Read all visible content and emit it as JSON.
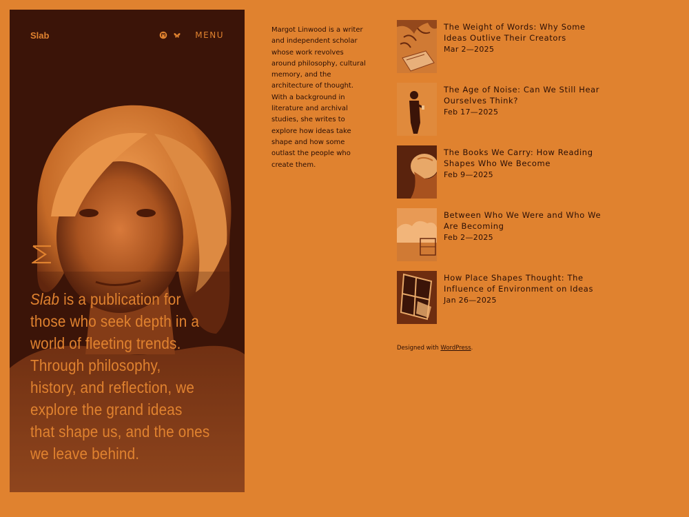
{
  "site": {
    "title": "Slab",
    "menu_label": "MENU",
    "icons": [
      "mastodon-icon",
      "bluesky-icon"
    ],
    "tagline_brand": "Slab",
    "tagline_rest": " is a publication for those who seek depth in a world of fleeting trends. Through philosophy, history, and reflection, we explore the grand ideas that shape us, and the ones we leave behind."
  },
  "bio": {
    "text": "Margot Linwood is a writer and independent scholar whose work revolves around philosophy, cultural memory, and the architecture of thought. With a background in literature and archival studies, she writes to explore how ideas take shape and how some outlast the people who create them."
  },
  "posts": [
    {
      "title": "The Weight of Words: Why Some Ideas Outlive Their Creators",
      "date": "Mar 2—2025",
      "thumb": "leaves-and-paper"
    },
    {
      "title": "The Age of Noise: Can We Still Hear Ourselves Think?",
      "date": "Feb 17—2025",
      "thumb": "person-with-phone"
    },
    {
      "title": "The Books We Carry: How Reading Shapes Who We Become",
      "date": "Feb 9—2025",
      "thumb": "reader-head"
    },
    {
      "title": "Between Who We Were and Who We Are Becoming",
      "date": "Feb 2—2025",
      "thumb": "clouds-and-bench"
    },
    {
      "title": "How Place Shapes Thought: The Influence of Environment on Ideas",
      "date": "Jan 26—2025",
      "thumb": "window-light"
    }
  ],
  "footer": {
    "prefix": "Designed with ",
    "link": "WordPress",
    "suffix": "."
  },
  "colors": {
    "background": "#e0822f",
    "panel": "#3b1408",
    "text": "#2a0e05"
  }
}
